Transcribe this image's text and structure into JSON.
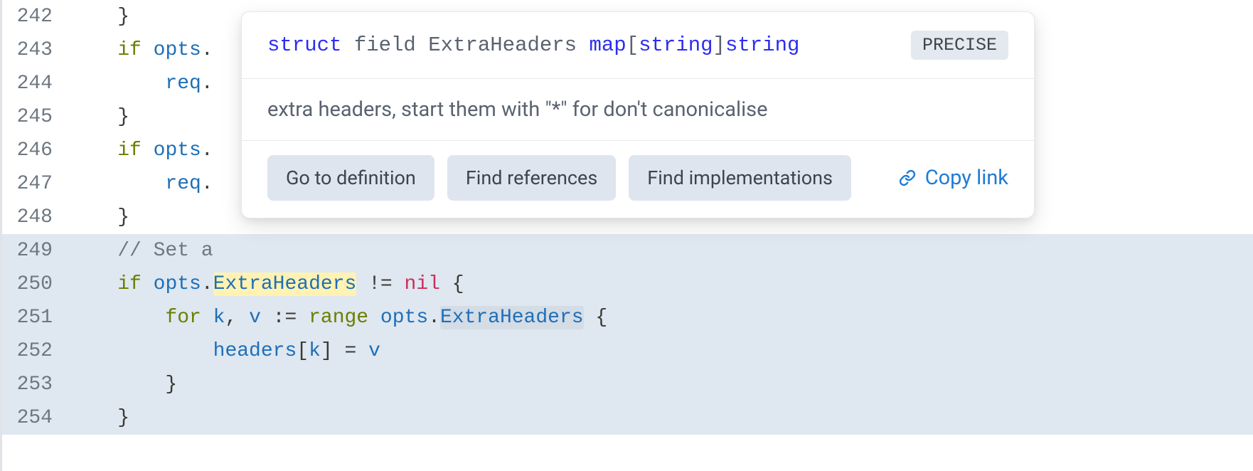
{
  "lines": [
    {
      "num": "242",
      "highlighted": false
    },
    {
      "num": "243",
      "highlighted": false
    },
    {
      "num": "244",
      "highlighted": false
    },
    {
      "num": "245",
      "highlighted": false
    },
    {
      "num": "246",
      "highlighted": false
    },
    {
      "num": "247",
      "highlighted": false
    },
    {
      "num": "248",
      "highlighted": false
    },
    {
      "num": "249",
      "highlighted": true
    },
    {
      "num": "250",
      "highlighted": true
    },
    {
      "num": "251",
      "highlighted": true
    },
    {
      "num": "252",
      "highlighted": true
    },
    {
      "num": "253",
      "highlighted": true
    },
    {
      "num": "254",
      "highlighted": true
    }
  ],
  "code": {
    "l242_brace": "}",
    "l243_if": "if",
    "l243_opts": "opts",
    "l243_dot": ".",
    "l244_req": "req",
    "l244_dot": ".",
    "l245_brace": "}",
    "l246_if": "if",
    "l246_opts": "opts",
    "l246_dot": ".",
    "l247_req": "req",
    "l247_dot": ".",
    "l248_brace": "}",
    "l249_comment": "// Set a",
    "l250_if": "if",
    "l250_opts": "opts",
    "l250_dot1": ".",
    "l250_extra": "ExtraHeaders",
    "l250_neq": " != ",
    "l250_nil": "nil",
    "l250_brace": " {",
    "l251_for": "for",
    "l251_k": " k",
    "l251_comma": ", ",
    "l251_v": "v",
    "l251_assign": " := ",
    "l251_range": "range",
    "l251_opts": " opts",
    "l251_dot": ".",
    "l251_extra": "ExtraHeaders",
    "l251_brace": " {",
    "l252_headers": "headers",
    "l252_bracket1": "[",
    "l252_k": "k",
    "l252_bracket2": "] = ",
    "l252_v": "v",
    "l253_brace": "}",
    "l254_brace": "}"
  },
  "popup": {
    "sig_struct": "struct",
    "sig_field": " field ",
    "sig_name": "ExtraHeaders",
    "sig_space": " ",
    "sig_map": "map",
    "sig_b1": "[",
    "sig_str1": "string",
    "sig_b2": "]",
    "sig_str2": "string",
    "badge": "PRECISE",
    "doc": "extra headers, start them with \"*\" for don't canonicalise",
    "actions": {
      "definition": "Go to definition",
      "references": "Find references",
      "implementations": "Find implementations"
    },
    "copy_link": "Copy link"
  }
}
